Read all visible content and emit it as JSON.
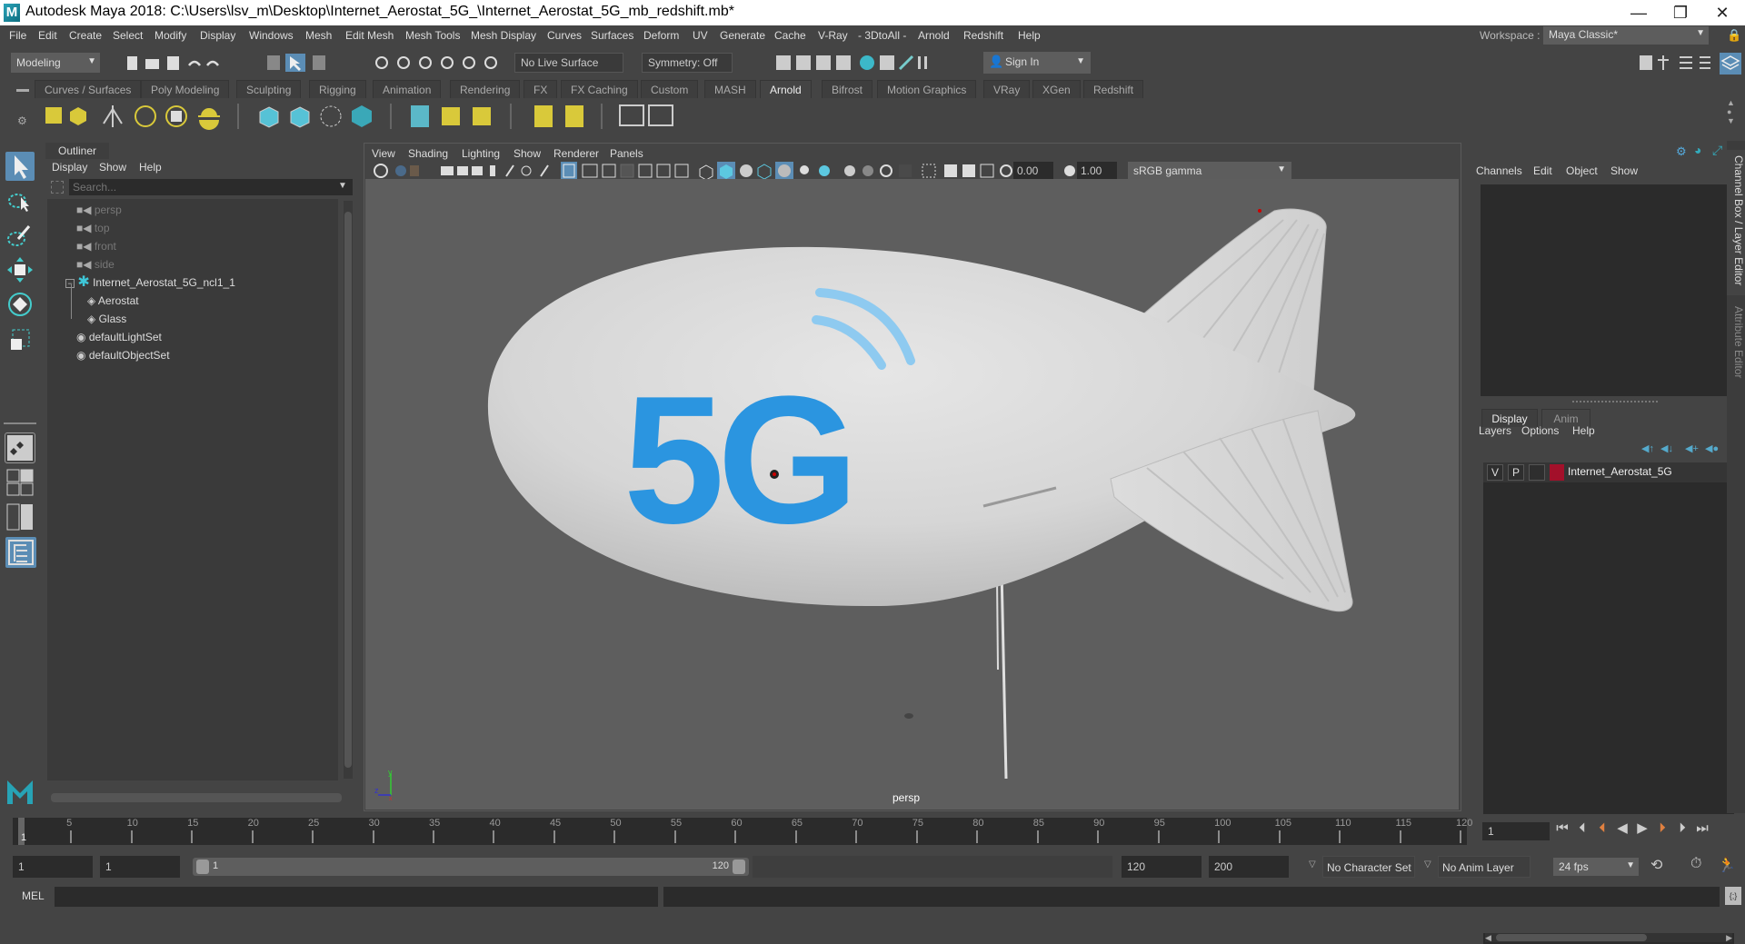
{
  "window": {
    "title": "Autodesk Maya 2018: C:\\Users\\lsv_m\\Desktop\\Internet_Aerostat_5G_\\Internet_Aerostat_5G_mb_redshift.mb*",
    "logo": "M",
    "minimize": "—",
    "maximize": "❐",
    "close": "✕"
  },
  "menubar": {
    "items": [
      "File",
      "Edit",
      "Create",
      "Select",
      "Modify",
      "Display",
      "Windows",
      "Mesh",
      "Edit Mesh",
      "Mesh Tools",
      "Mesh Display",
      "Curves",
      "Surfaces",
      "Deform",
      "UV",
      "Generate",
      "Cache",
      "V-Ray",
      "- 3DtoAll -",
      "Arnold",
      "Redshift",
      "Help"
    ],
    "workspace_label": "Workspace :",
    "workspace_value": "Maya Classic*"
  },
  "statusline": {
    "menuset": "Modeling",
    "live_surface": "No Live Surface",
    "symmetry": "Symmetry: Off",
    "sign_in": "Sign In"
  },
  "shelf": {
    "tabs": [
      "Curves / Surfaces",
      "Poly Modeling",
      "Sculpting",
      "Rigging",
      "Animation",
      "Rendering",
      "FX",
      "FX Caching",
      "Custom",
      "MASH",
      "Arnold",
      "Bifrost",
      "Motion Graphics",
      "VRay",
      "XGen",
      "Redshift"
    ],
    "active_tab": "Arnold",
    "icons": [
      "area-light-icon",
      "mesh-light-icon",
      "photometric-light-icon",
      "skydome-light-icon",
      "light-portal-icon",
      "physical-sky-icon",
      "create-standin-icon",
      "export-standin-icon",
      "curve-collector-icon",
      "volume-icon",
      "render-view-icon",
      "tx-manager-icon",
      "flush-cache-icon",
      "texture-toggle-icon",
      "render-setup-icon",
      "arnold-renderview-icon",
      "render-playblast-icon"
    ]
  },
  "outliner": {
    "tab": "Outliner",
    "menus": [
      "Display",
      "Show",
      "Help"
    ],
    "search_placeholder": "Search...",
    "items": [
      {
        "label": "persp",
        "type": "camera",
        "dim": true
      },
      {
        "label": "top",
        "type": "camera",
        "dim": true
      },
      {
        "label": "front",
        "type": "camera",
        "dim": true
      },
      {
        "label": "side",
        "type": "camera",
        "dim": true
      },
      {
        "label": "Internet_Aerostat_5G_ncl1_1",
        "type": "group",
        "expanded": true
      },
      {
        "label": "Aerostat",
        "type": "mesh",
        "child": true
      },
      {
        "label": "Glass",
        "type": "mesh",
        "child": true
      },
      {
        "label": "defaultLightSet",
        "type": "set"
      },
      {
        "label": "defaultObjectSet",
        "type": "set"
      }
    ]
  },
  "viewport": {
    "menus": [
      "View",
      "Shading",
      "Lighting",
      "Show",
      "Renderer",
      "Panels"
    ],
    "exposure": "0.00",
    "gamma": "1.00",
    "color_mgmt": "sRGB gamma",
    "camera_label": "persp",
    "logo_text": "5G",
    "logo_color": "#2b95e0",
    "axis": {
      "y": "y",
      "z": "z",
      "x": "x"
    }
  },
  "channelbox": {
    "menus": [
      "Channels",
      "Edit",
      "Object",
      "Show"
    ]
  },
  "layer_editor": {
    "tabs": [
      "Display",
      "Anim"
    ],
    "active_tab": "Display",
    "menus": [
      "Layers",
      "Options",
      "Help"
    ],
    "layers": [
      {
        "v": "V",
        "p": "P",
        "name": "Internet_Aerostat_5G",
        "color": "#a3102a"
      }
    ]
  },
  "vertical_tabs": [
    "Channel Box / Layer Editor",
    "Attribute Editor"
  ],
  "timeline": {
    "ticks": [
      5,
      10,
      15,
      20,
      25,
      30,
      35,
      40,
      45,
      50,
      55,
      60,
      65,
      70,
      75,
      80,
      85,
      90,
      95,
      100,
      105,
      110,
      115,
      120
    ],
    "start": 1,
    "end": 120,
    "current_frame": "1",
    "current_marker": "1"
  },
  "range": {
    "start_time": "1",
    "playback_start": "1",
    "slider_start": "1",
    "slider_end": "120",
    "playback_end": "120",
    "end_time": "200",
    "character_set": "No Character Set",
    "anim_layer": "No Anim Layer",
    "fps": "24 fps"
  },
  "mel": {
    "label": "MEL",
    "value": ""
  }
}
